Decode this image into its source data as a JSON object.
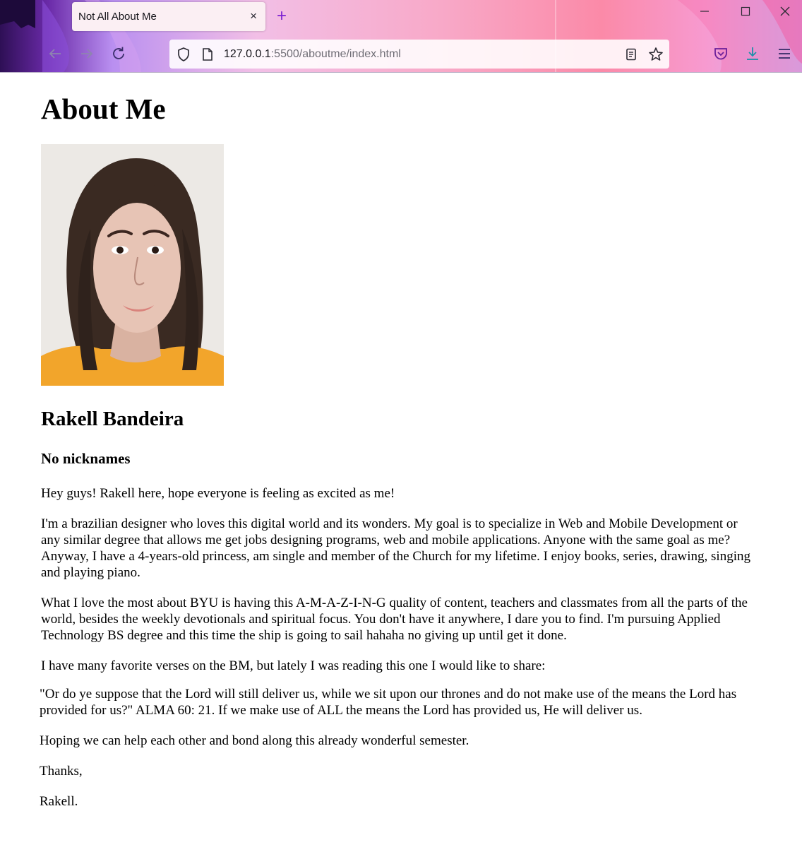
{
  "browser": {
    "tab_title": "Not All About Me",
    "tab_close": "×",
    "new_tab": "+",
    "url_host": "127.0.0.1",
    "url_rest": ":5500/aboutme/index.html"
  },
  "page": {
    "heading": "About Me",
    "name": "Rakell Bandeira",
    "nickname": "No nicknames",
    "paragraphs": [
      "Hey guys! Rakell here, hope everyone is feeling as excited as me!",
      "I'm a brazilian designer who loves this digital world and its wonders. My goal is to specialize in Web and Mobile Development or any similar degree that allows me get jobs designing programs, web and mobile applications. Anyone with the same goal as me? Anyway, I have a 4-years-old princess, am single and member of the Church for my lifetime. I enjoy books, series, drawing, singing and playing piano.",
      "What I love the most about BYU is having this A-M-A-Z-I-N-G quality of content, teachers and classmates from all the parts of the world, besides the weekly devotionals and spiritual focus. You don't have it anywhere, I dare you to find. I'm pursuing Applied Technology BS degree and this time the ship is going to sail hahaha no giving up until get it done.",
      "I have many favorite verses on the BM, but lately I was reading this one I would like to share:",
      "\"Or do ye suppose that the Lord will still deliver us, while we sit upon our thrones and do not make use of the means the Lord has provided for us?\" ALMA 60: 21. If we make use of ALL the means the Lord has provided us, He will deliver us.",
      "Hoping we can help each other and bond along this already wonderful semester.",
      "Thanks,",
      "Rakell."
    ]
  },
  "colors": {
    "accent": "#7a1fd1",
    "text": "#000000"
  }
}
